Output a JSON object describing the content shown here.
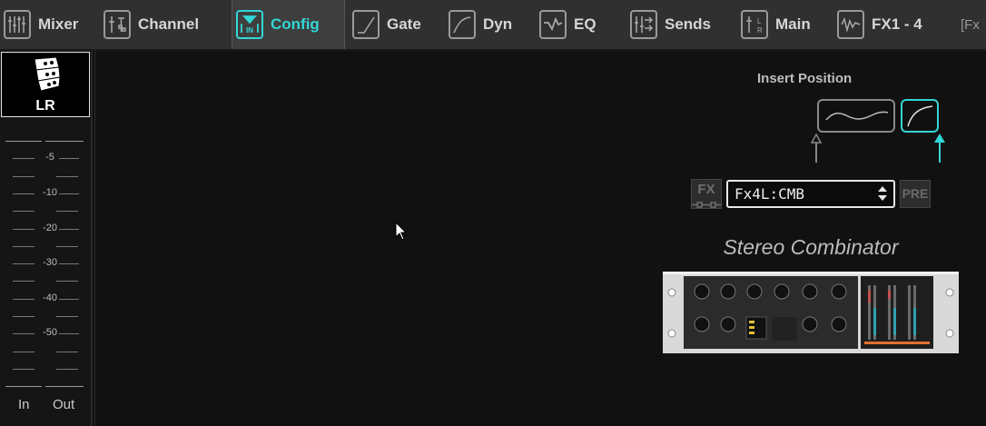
{
  "tabs": [
    {
      "label": "Mixer",
      "icon": "mixer-faders-icon",
      "active": false
    },
    {
      "label": "Channel",
      "icon": "channel-strip-icon",
      "active": false
    },
    {
      "label": "Config",
      "icon": "config-input-icon",
      "active": true
    },
    {
      "label": "Gate",
      "icon": "gate-curve-icon",
      "active": false
    },
    {
      "label": "Dyn",
      "icon": "dynamics-curve-icon",
      "active": false
    },
    {
      "label": "EQ",
      "icon": "eq-curve-icon",
      "active": false
    },
    {
      "label": "Sends",
      "icon": "sends-icon",
      "active": false
    },
    {
      "label": "Main",
      "icon": "main-lr-icon",
      "active": false
    },
    {
      "label": "FX1 - 4",
      "icon": "fx-wave-icon",
      "active": false
    },
    {
      "label": "",
      "icon": "fx-partial-icon",
      "active": false
    }
  ],
  "partial_tab_text": "[Fx",
  "channel": {
    "label": "LR",
    "icon": "speaker-array-icon"
  },
  "meter": {
    "scale": [
      "-5",
      "-10",
      "-20",
      "-30",
      "-40",
      "-50"
    ],
    "in_label": "In",
    "out_label": "Out"
  },
  "insert": {
    "title": "Insert Position",
    "selected_position": "post-dynamics"
  },
  "fx": {
    "button_label": "FX",
    "selected_slot": "Fx4L:CMB",
    "pre_label": "PRE",
    "effect_name": "Stereo Combinator"
  },
  "colors": {
    "accent": "#33d6d6",
    "background": "#111111",
    "tabbar": "#303030"
  }
}
